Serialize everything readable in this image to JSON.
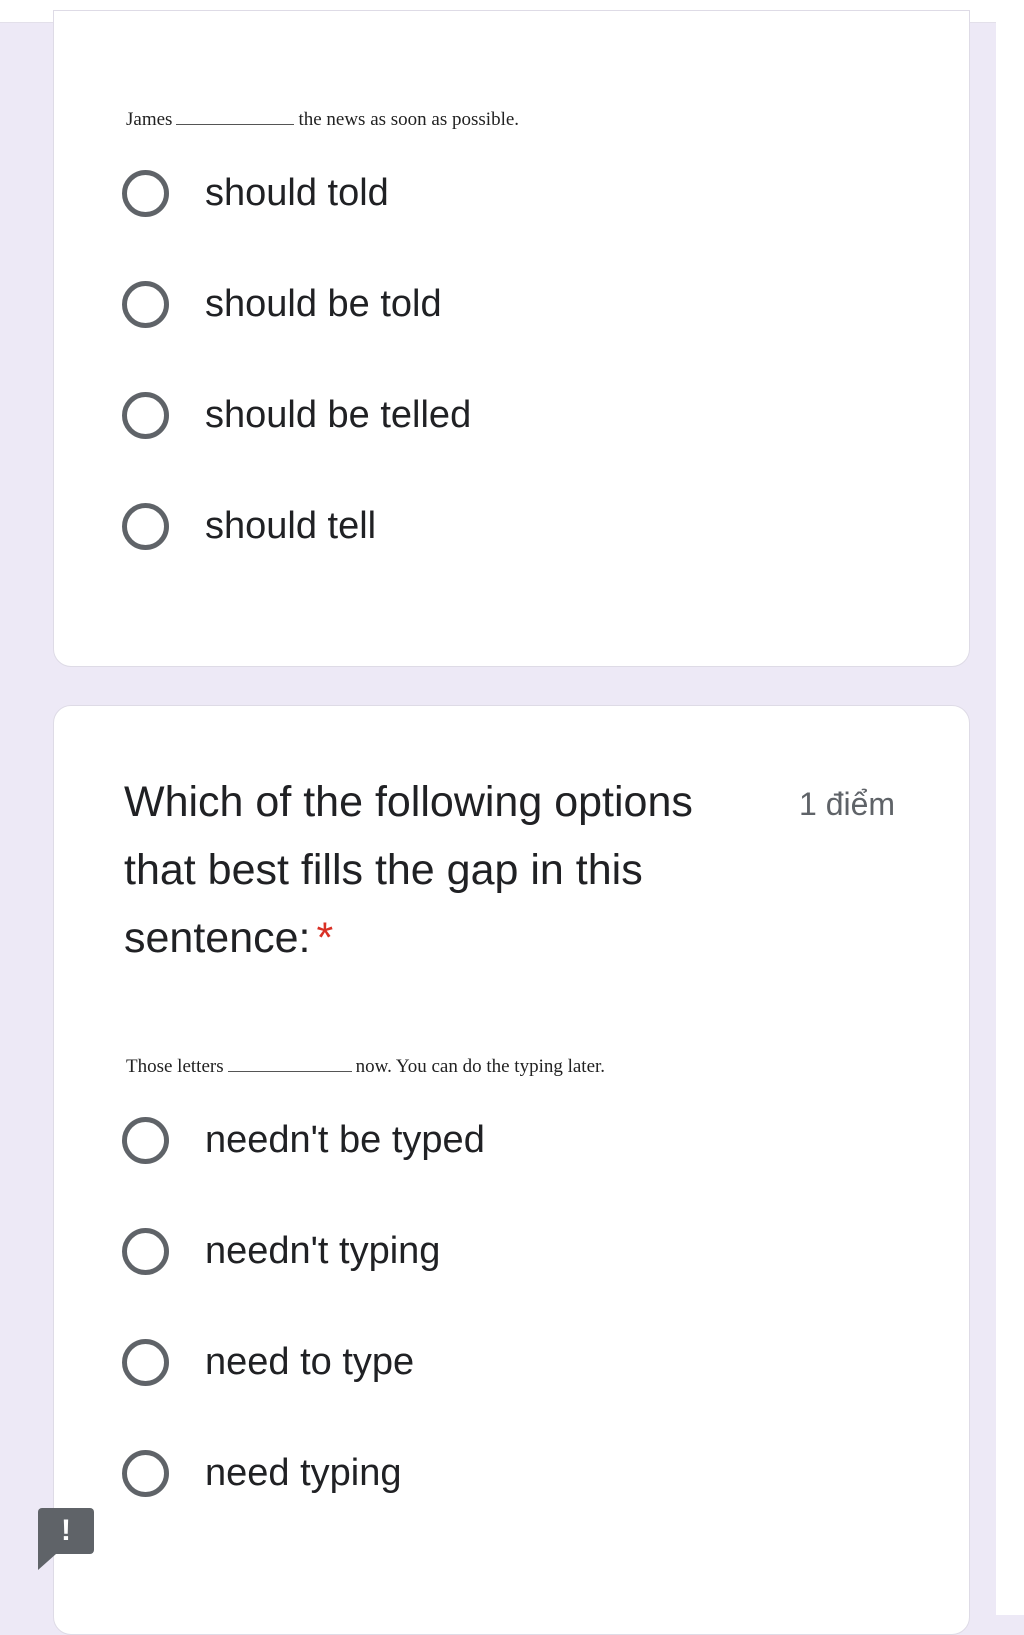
{
  "questions": [
    {
      "sentence": {
        "before": "James",
        "after": "the news as soon as possible."
      },
      "options": [
        "should told",
        "should be told",
        "should be telled",
        "should tell"
      ]
    },
    {
      "title": "Which of the following options that best fills the gap in this sentence:",
      "required_marker": "*",
      "points": "1 điểm",
      "sentence": {
        "before": "Those letters",
        "after": "now. You can do the typing later."
      },
      "options": [
        "needn't be typed",
        "needn't typing",
        "need to type",
        "need typing"
      ]
    }
  ],
  "feedback_button": {
    "icon": "exclamation-icon",
    "label": "!"
  },
  "colors": {
    "background": "#ede9f6",
    "radio": "#5f6368",
    "required": "#d93025"
  }
}
